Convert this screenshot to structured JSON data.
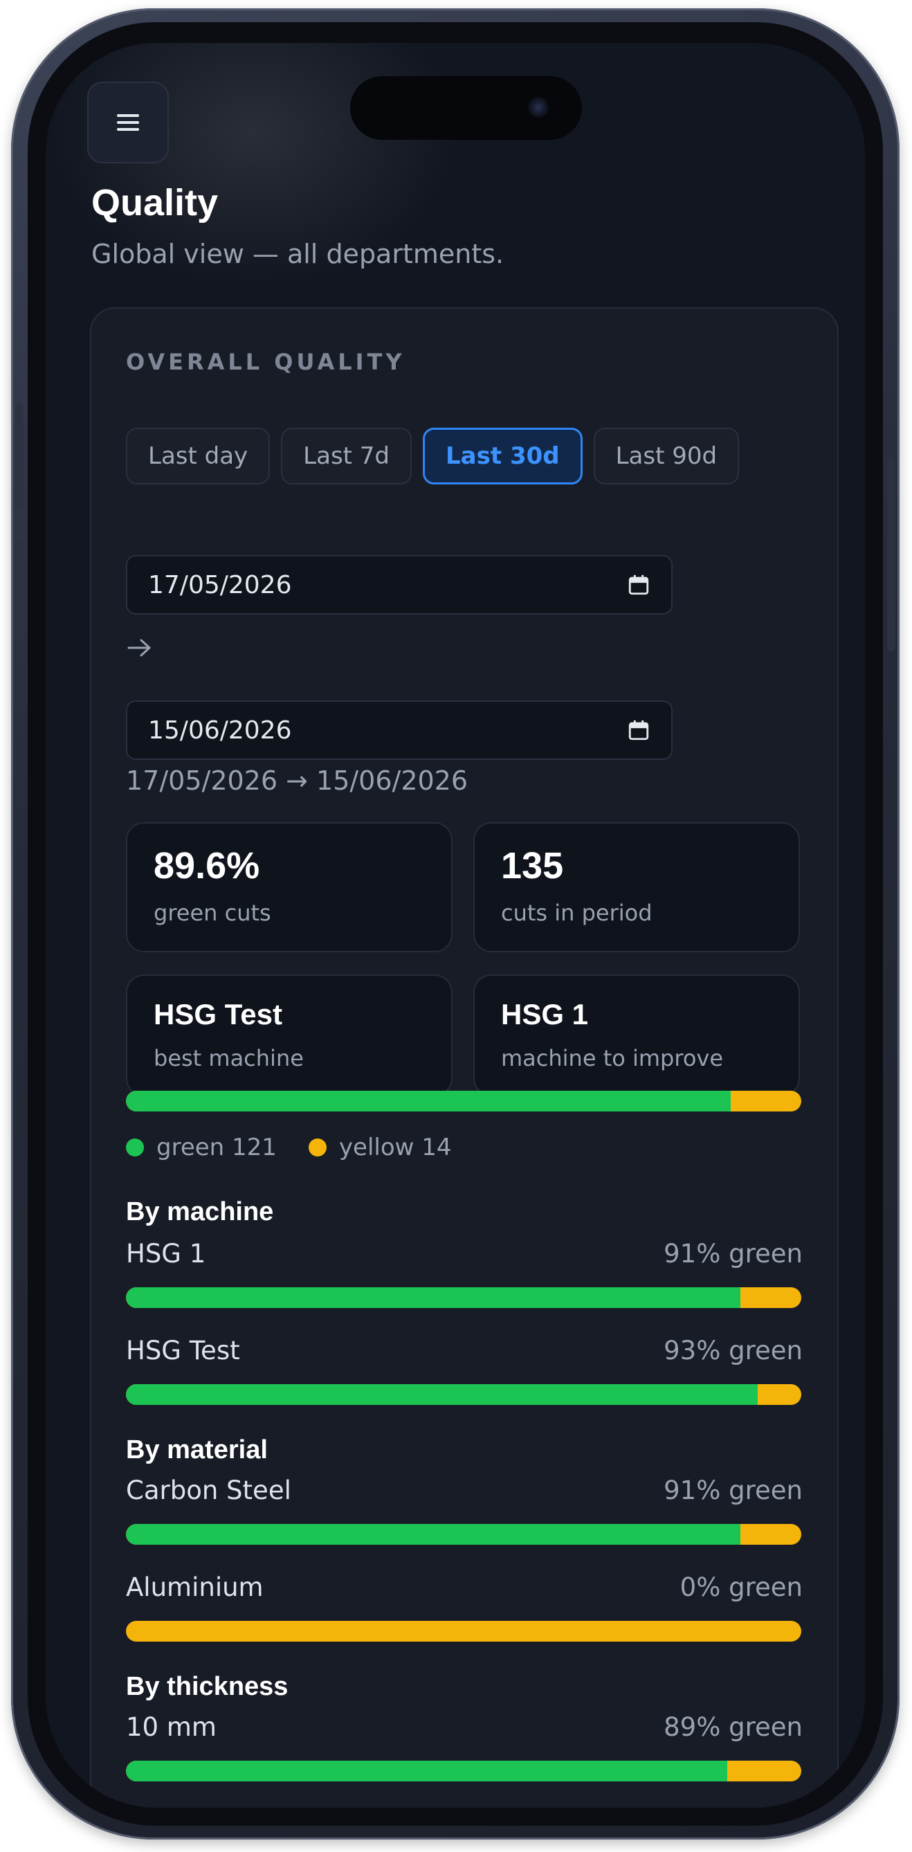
{
  "app": {
    "title": "Quality",
    "subtitle": "Global view — all departments."
  },
  "overall": {
    "heading": "OVERALL QUALITY",
    "periods": [
      {
        "label": "Last day",
        "active": false
      },
      {
        "label": "Last 7d",
        "active": false
      },
      {
        "label": "Last 30d",
        "active": true
      },
      {
        "label": "Last 90d",
        "active": false
      }
    ],
    "date_from": "17/05/2026",
    "date_to": "15/06/2026",
    "range_text": "17/05/2026 → 15/06/2026",
    "stats": {
      "green_pct": "89.6%",
      "green_pct_label": "green cuts",
      "cuts": "135",
      "cuts_label": "cuts in period",
      "best_machine": "HSG Test",
      "best_machine_label": "best machine",
      "improve_machine": "HSG 1",
      "improve_machine_label": "machine to improve"
    },
    "overall_bar_green_fraction": 0.896,
    "legend": {
      "green": "green 121",
      "yellow": "yellow 14"
    }
  },
  "sections": {
    "by_machine": {
      "title": "By machine",
      "rows": [
        {
          "label": "HSG 1",
          "pct_text": "91% green",
          "green_fraction": 0.91
        },
        {
          "label": "HSG Test",
          "pct_text": "93% green",
          "green_fraction": 0.935
        }
      ]
    },
    "by_material": {
      "title": "By material",
      "rows": [
        {
          "label": "Carbon Steel",
          "pct_text": "91% green",
          "green_fraction": 0.91
        },
        {
          "label": "Aluminium",
          "pct_text": "0% green",
          "green_fraction": 0.0
        }
      ]
    },
    "by_thickness": {
      "title": "By thickness",
      "rows": [
        {
          "label": "10 mm",
          "pct_text": "89% green",
          "green_fraction": 0.89
        }
      ]
    }
  },
  "colors": {
    "green": "#1cc454",
    "yellow": "#f5b40a",
    "accent": "#2f86f6",
    "background": "#121620"
  },
  "icons": {
    "menu": "hamburger-menu-icon",
    "calendar": "calendar-icon",
    "arrow": "arrow-right-icon"
  }
}
